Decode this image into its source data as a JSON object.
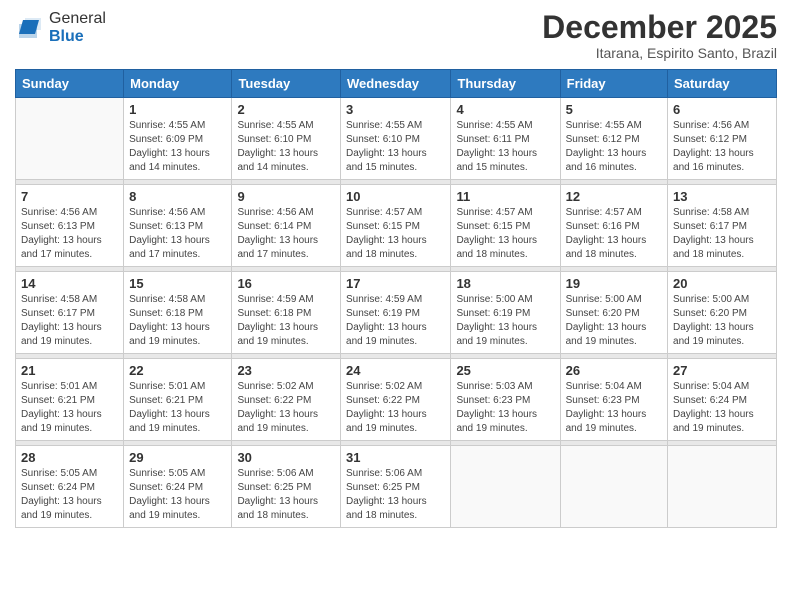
{
  "header": {
    "logo_general": "General",
    "logo_blue": "Blue",
    "month": "December 2025",
    "location": "Itarana, Espirito Santo, Brazil"
  },
  "weekdays": [
    "Sunday",
    "Monday",
    "Tuesday",
    "Wednesday",
    "Thursday",
    "Friday",
    "Saturday"
  ],
  "weeks": [
    [
      {
        "day": "",
        "sunrise": "",
        "sunset": "",
        "daylight": ""
      },
      {
        "day": "1",
        "sunrise": "Sunrise: 4:55 AM",
        "sunset": "Sunset: 6:09 PM",
        "daylight": "Daylight: 13 hours and 14 minutes."
      },
      {
        "day": "2",
        "sunrise": "Sunrise: 4:55 AM",
        "sunset": "Sunset: 6:10 PM",
        "daylight": "Daylight: 13 hours and 14 minutes."
      },
      {
        "day": "3",
        "sunrise": "Sunrise: 4:55 AM",
        "sunset": "Sunset: 6:10 PM",
        "daylight": "Daylight: 13 hours and 15 minutes."
      },
      {
        "day": "4",
        "sunrise": "Sunrise: 4:55 AM",
        "sunset": "Sunset: 6:11 PM",
        "daylight": "Daylight: 13 hours and 15 minutes."
      },
      {
        "day": "5",
        "sunrise": "Sunrise: 4:55 AM",
        "sunset": "Sunset: 6:12 PM",
        "daylight": "Daylight: 13 hours and 16 minutes."
      },
      {
        "day": "6",
        "sunrise": "Sunrise: 4:56 AM",
        "sunset": "Sunset: 6:12 PM",
        "daylight": "Daylight: 13 hours and 16 minutes."
      }
    ],
    [
      {
        "day": "7",
        "sunrise": "Sunrise: 4:56 AM",
        "sunset": "Sunset: 6:13 PM",
        "daylight": "Daylight: 13 hours and 17 minutes."
      },
      {
        "day": "8",
        "sunrise": "Sunrise: 4:56 AM",
        "sunset": "Sunset: 6:13 PM",
        "daylight": "Daylight: 13 hours and 17 minutes."
      },
      {
        "day": "9",
        "sunrise": "Sunrise: 4:56 AM",
        "sunset": "Sunset: 6:14 PM",
        "daylight": "Daylight: 13 hours and 17 minutes."
      },
      {
        "day": "10",
        "sunrise": "Sunrise: 4:57 AM",
        "sunset": "Sunset: 6:15 PM",
        "daylight": "Daylight: 13 hours and 18 minutes."
      },
      {
        "day": "11",
        "sunrise": "Sunrise: 4:57 AM",
        "sunset": "Sunset: 6:15 PM",
        "daylight": "Daylight: 13 hours and 18 minutes."
      },
      {
        "day": "12",
        "sunrise": "Sunrise: 4:57 AM",
        "sunset": "Sunset: 6:16 PM",
        "daylight": "Daylight: 13 hours and 18 minutes."
      },
      {
        "day": "13",
        "sunrise": "Sunrise: 4:58 AM",
        "sunset": "Sunset: 6:17 PM",
        "daylight": "Daylight: 13 hours and 18 minutes."
      }
    ],
    [
      {
        "day": "14",
        "sunrise": "Sunrise: 4:58 AM",
        "sunset": "Sunset: 6:17 PM",
        "daylight": "Daylight: 13 hours and 19 minutes."
      },
      {
        "day": "15",
        "sunrise": "Sunrise: 4:58 AM",
        "sunset": "Sunset: 6:18 PM",
        "daylight": "Daylight: 13 hours and 19 minutes."
      },
      {
        "day": "16",
        "sunrise": "Sunrise: 4:59 AM",
        "sunset": "Sunset: 6:18 PM",
        "daylight": "Daylight: 13 hours and 19 minutes."
      },
      {
        "day": "17",
        "sunrise": "Sunrise: 4:59 AM",
        "sunset": "Sunset: 6:19 PM",
        "daylight": "Daylight: 13 hours and 19 minutes."
      },
      {
        "day": "18",
        "sunrise": "Sunrise: 5:00 AM",
        "sunset": "Sunset: 6:19 PM",
        "daylight": "Daylight: 13 hours and 19 minutes."
      },
      {
        "day": "19",
        "sunrise": "Sunrise: 5:00 AM",
        "sunset": "Sunset: 6:20 PM",
        "daylight": "Daylight: 13 hours and 19 minutes."
      },
      {
        "day": "20",
        "sunrise": "Sunrise: 5:00 AM",
        "sunset": "Sunset: 6:20 PM",
        "daylight": "Daylight: 13 hours and 19 minutes."
      }
    ],
    [
      {
        "day": "21",
        "sunrise": "Sunrise: 5:01 AM",
        "sunset": "Sunset: 6:21 PM",
        "daylight": "Daylight: 13 hours and 19 minutes."
      },
      {
        "day": "22",
        "sunrise": "Sunrise: 5:01 AM",
        "sunset": "Sunset: 6:21 PM",
        "daylight": "Daylight: 13 hours and 19 minutes."
      },
      {
        "day": "23",
        "sunrise": "Sunrise: 5:02 AM",
        "sunset": "Sunset: 6:22 PM",
        "daylight": "Daylight: 13 hours and 19 minutes."
      },
      {
        "day": "24",
        "sunrise": "Sunrise: 5:02 AM",
        "sunset": "Sunset: 6:22 PM",
        "daylight": "Daylight: 13 hours and 19 minutes."
      },
      {
        "day": "25",
        "sunrise": "Sunrise: 5:03 AM",
        "sunset": "Sunset: 6:23 PM",
        "daylight": "Daylight: 13 hours and 19 minutes."
      },
      {
        "day": "26",
        "sunrise": "Sunrise: 5:04 AM",
        "sunset": "Sunset: 6:23 PM",
        "daylight": "Daylight: 13 hours and 19 minutes."
      },
      {
        "day": "27",
        "sunrise": "Sunrise: 5:04 AM",
        "sunset": "Sunset: 6:24 PM",
        "daylight": "Daylight: 13 hours and 19 minutes."
      }
    ],
    [
      {
        "day": "28",
        "sunrise": "Sunrise: 5:05 AM",
        "sunset": "Sunset: 6:24 PM",
        "daylight": "Daylight: 13 hours and 19 minutes."
      },
      {
        "day": "29",
        "sunrise": "Sunrise: 5:05 AM",
        "sunset": "Sunset: 6:24 PM",
        "daylight": "Daylight: 13 hours and 19 minutes."
      },
      {
        "day": "30",
        "sunrise": "Sunrise: 5:06 AM",
        "sunset": "Sunset: 6:25 PM",
        "daylight": "Daylight: 13 hours and 18 minutes."
      },
      {
        "day": "31",
        "sunrise": "Sunrise: 5:06 AM",
        "sunset": "Sunset: 6:25 PM",
        "daylight": "Daylight: 13 hours and 18 minutes."
      },
      {
        "day": "",
        "sunrise": "",
        "sunset": "",
        "daylight": ""
      },
      {
        "day": "",
        "sunrise": "",
        "sunset": "",
        "daylight": ""
      },
      {
        "day": "",
        "sunrise": "",
        "sunset": "",
        "daylight": ""
      }
    ]
  ]
}
